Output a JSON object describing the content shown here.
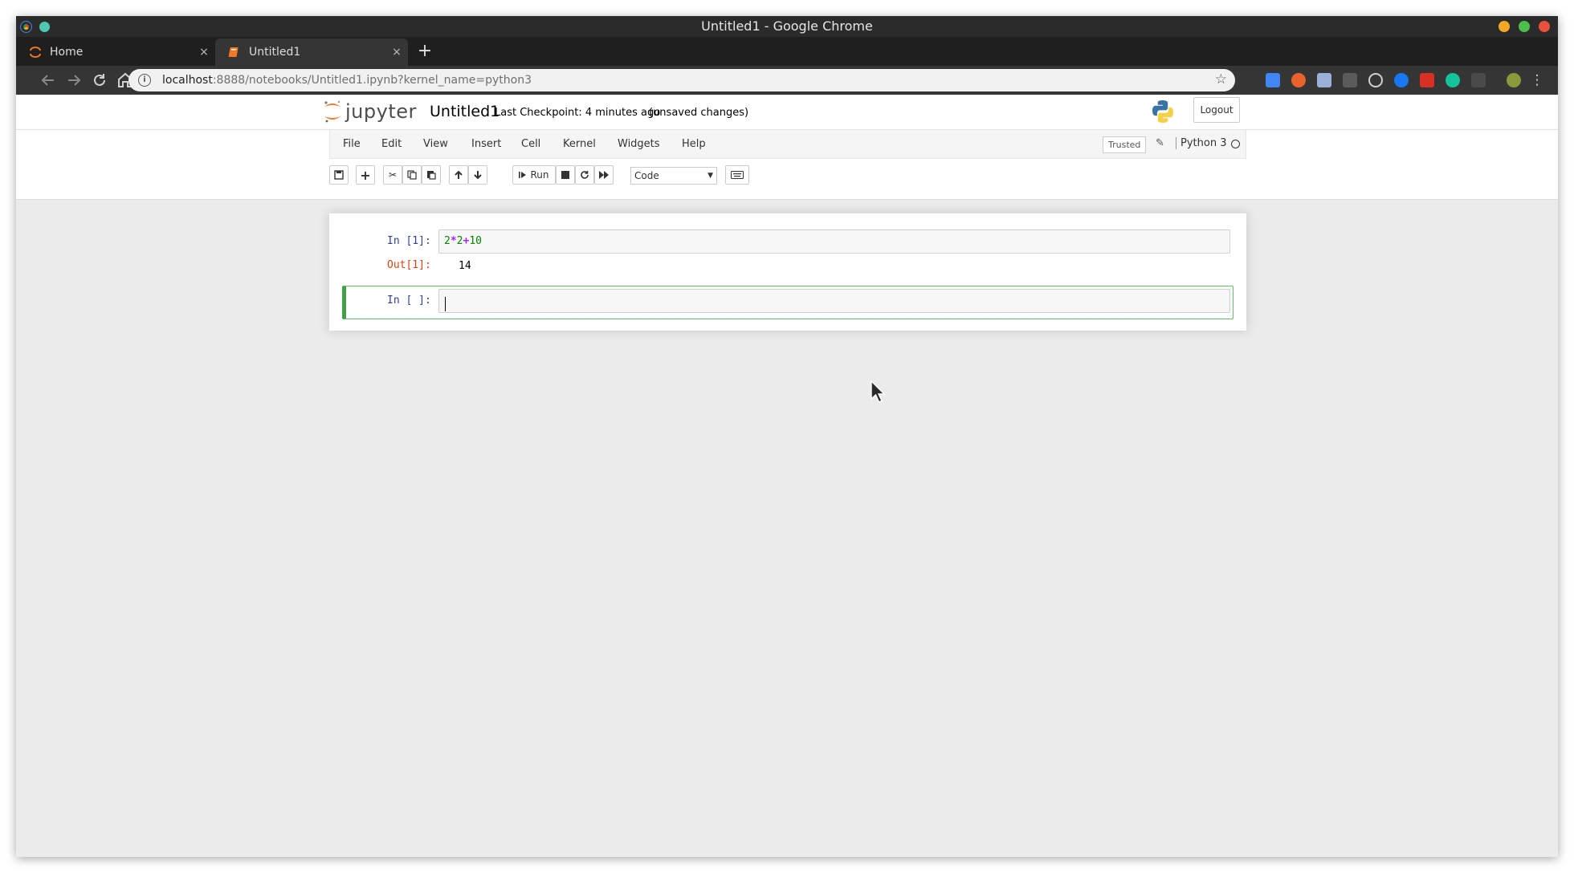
{
  "window": {
    "title": "Untitled1 - Google Chrome"
  },
  "tabs": [
    {
      "label": "Home",
      "icon": "jupyter-tab-icon",
      "close": "×"
    },
    {
      "label": "Untitled1",
      "icon": "notebook-tab-icon",
      "close": "×"
    }
  ],
  "newtab_label": "+",
  "address": {
    "host": "localhost",
    "rest": ":8888/notebooks/Untitled1.ipynb?kernel_name=python3"
  },
  "header": {
    "logo_text": "jupyter",
    "notebook_name": "Untitled1",
    "checkpoint": "Last Checkpoint: 4 minutes ago",
    "unsaved": "(unsaved changes)",
    "logout": "Logout"
  },
  "menu": {
    "items": [
      "File",
      "Edit",
      "View",
      "Insert",
      "Cell",
      "Kernel",
      "Widgets",
      "Help"
    ],
    "trusted": "Trusted",
    "kernel_name": "Python 3"
  },
  "toolbar": {
    "run_label": "Run",
    "cell_type": "Code"
  },
  "cells": {
    "cell1": {
      "in_prompt": "In [1]:",
      "code_a": "2",
      "op_a": "*",
      "code_b": "2",
      "op_b": "+",
      "code_c": "10",
      "out_prompt": "Out[1]:",
      "output": "14"
    },
    "cell2": {
      "in_prompt": "In [ ]:"
    }
  },
  "colors": {
    "accent_orange": "#f37726",
    "selected_border": "#42a047",
    "prompt_in": "#303f9f",
    "prompt_out": "#d84315"
  }
}
